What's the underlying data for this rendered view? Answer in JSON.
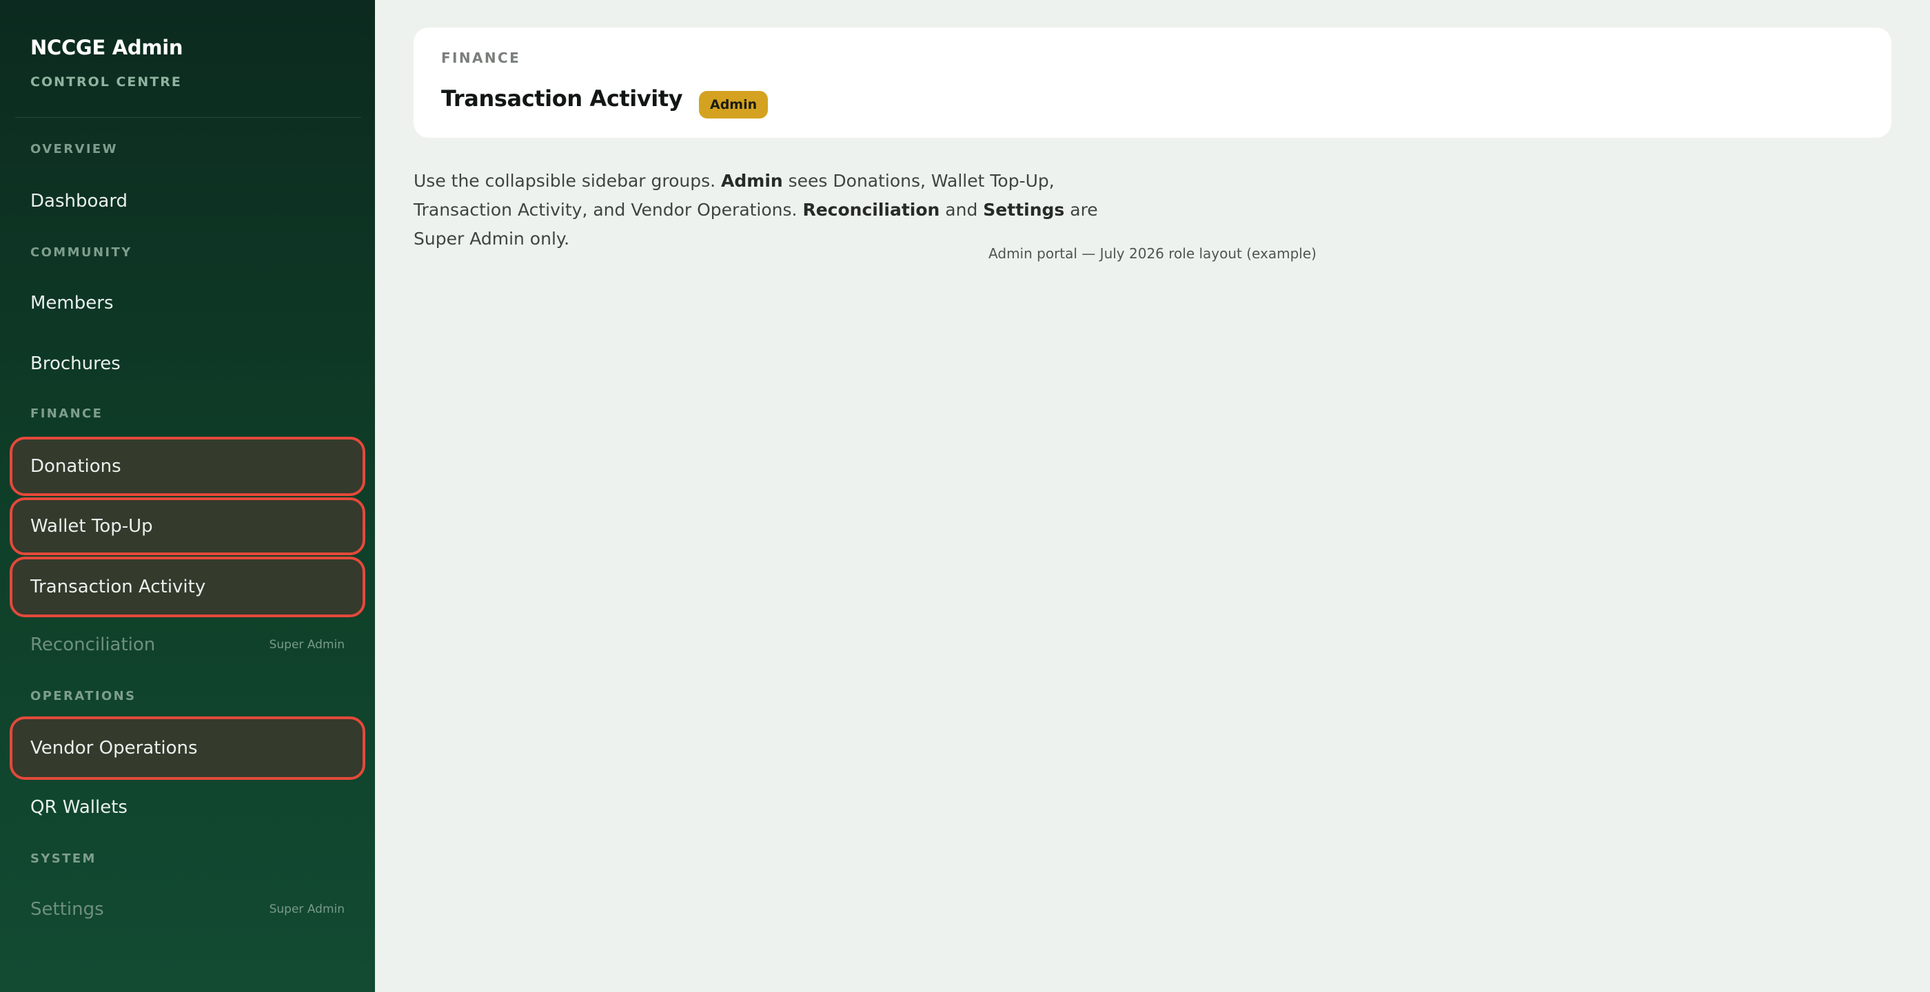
{
  "sidebar": {
    "brand_title": "NCCGE Admin",
    "brand_subtitle": "CONTROL CENTRE",
    "sections": {
      "overview": "OVERVIEW",
      "community": "COMMUNITY",
      "finance": "FINANCE",
      "operations": "OPERATIONS",
      "system": "SYSTEM"
    },
    "items": {
      "dashboard": "Dashboard",
      "members": "Members",
      "brochures": "Brochures",
      "donations": "Donations",
      "wallet_topup": "Wallet Top-Up",
      "transaction_activity": "Transaction Activity",
      "reconciliation": "Reconciliation",
      "vendor_operations": "Vendor Operations",
      "qr_wallets": "QR Wallets",
      "settings": "Settings"
    },
    "role_note": "Super Admin"
  },
  "header": {
    "eyebrow": "FINANCE",
    "title": "Transaction Activity",
    "badge": "Admin"
  },
  "description": {
    "p1": "Use the collapsible sidebar groups. ",
    "b1": "Admin",
    "p2": " sees Donations, Wallet Top-Up, Transaction Activity, and Vendor Operations. ",
    "b2": "Reconciliation",
    "p3": " and ",
    "b3": "Settings",
    "p4": " are Super Admin only."
  },
  "footer_note": "Admin portal — July 2026 role layout (example)",
  "colors": {
    "sidebar_dark": "#0c2a1f",
    "highlight_border": "#e4493a",
    "badge": "#d4a220"
  }
}
